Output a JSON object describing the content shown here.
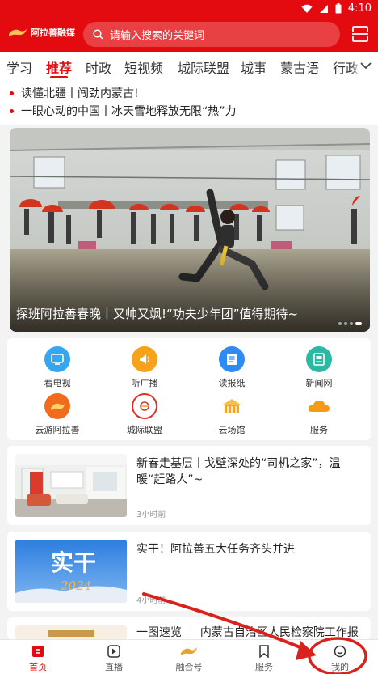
{
  "status": {
    "time": "4:10"
  },
  "header": {
    "logo_text": "阿拉善融媒",
    "search_placeholder": "请输入搜索的关键词"
  },
  "tabs": [
    "学习",
    "推荐",
    "时政",
    "短视频",
    "城际联盟",
    "城事",
    "蒙古语",
    "行政"
  ],
  "active_tab": "推荐",
  "headlines": [
    "读懂北疆丨闯劲内蒙古!",
    "一眼心动的中国丨冰天雪地释放无限“热”力"
  ],
  "hero": {
    "caption": "探班阿拉善春晚丨又帅又飒!“功夫少年团”值得期待~",
    "slides": 4,
    "current": 4
  },
  "services": [
    {
      "label": "看电视",
      "icon": "tv-icon",
      "color": "#35a6ef"
    },
    {
      "label": "听广播",
      "icon": "radio-icon",
      "color": "#f7a21b"
    },
    {
      "label": "读报纸",
      "icon": "newspaper-icon",
      "color": "#2f8bf0"
    },
    {
      "label": "新闻网",
      "icon": "news-web-icon",
      "color": "#2cb8a3"
    },
    {
      "label": "云游阿拉善",
      "icon": "cloud-tour-icon",
      "color": "#f26b1d"
    },
    {
      "label": "城际联盟",
      "icon": "city-alliance-icon",
      "color": "#e0322b"
    },
    {
      "label": "云场馆",
      "icon": "cloud-venue-icon",
      "color": "#f4a51c"
    },
    {
      "label": "服务",
      "icon": "service-icon",
      "color": "#f59a12"
    }
  ],
  "articles": [
    {
      "title": "新春走基层丨戈壁深处的“司机之家”，温暖“赶路人”~",
      "time": "3小时前"
    },
    {
      "title": "实干！阿拉善五大任务齐头并进",
      "time": "4小时前",
      "thumb_text": "实干",
      "thumb_year": "2024"
    },
    {
      "title": "一图速览 ｜ 内蒙古自治区人民检察院工作报"
    }
  ],
  "bottom_nav": [
    "首页",
    "直播",
    "融合号",
    "服务",
    "我的"
  ],
  "active_nav": "首页",
  "colors": {
    "brand": "#e30b0f",
    "annotation": "#d9221c"
  }
}
